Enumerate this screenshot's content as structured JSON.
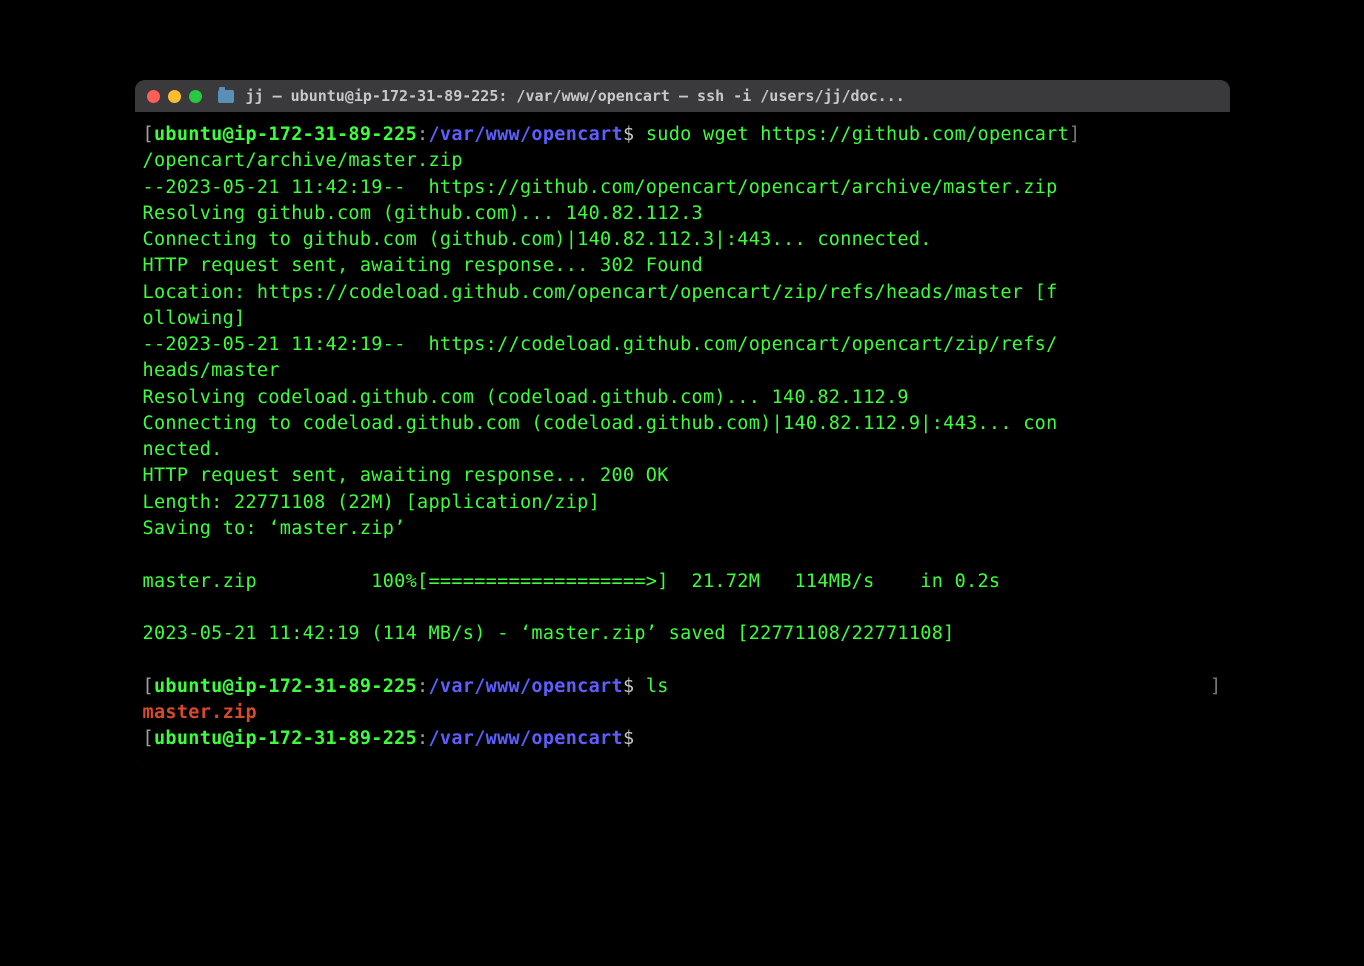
{
  "window": {
    "title": "jj — ubuntu@ip-172-31-89-225: /var/www/opencart — ssh -i /users/jj/doc..."
  },
  "prompt": {
    "lbracket": "[",
    "rbracket": "]",
    "user_host": "ubuntu@ip-172-31-89-225",
    "colon": ":",
    "path": "/var/www/opencart",
    "dollar": "$"
  },
  "commands": {
    "wget": " sudo wget https://github.com/opencart",
    "wget_cont": "/opencart/archive/master.zip",
    "ls": " ls"
  },
  "output": {
    "l1": "--2023-05-21 11:42:19--  https://github.com/opencart/opencart/archive/master.zip",
    "l2": "Resolving github.com (github.com)... 140.82.112.3",
    "l3": "Connecting to github.com (github.com)|140.82.112.3|:443... connected.",
    "l4": "HTTP request sent, awaiting response... 302 Found",
    "l5": "Location: https://codeload.github.com/opencart/opencart/zip/refs/heads/master [f",
    "l6": "ollowing]",
    "l7": "--2023-05-21 11:42:19--  https://codeload.github.com/opencart/opencart/zip/refs/",
    "l8": "heads/master",
    "l9": "Resolving codeload.github.com (codeload.github.com)... 140.82.112.9",
    "l10": "Connecting to codeload.github.com (codeload.github.com)|140.82.112.9|:443... con",
    "l11": "nected.",
    "l12": "HTTP request sent, awaiting response... 200 OK",
    "l13": "Length: 22771108 (22M) [application/zip]",
    "l14": "Saving to: ‘master.zip’",
    "blank": " ",
    "progress": "master.zip          100%[===================>]  21.72M   114MB/s    in 0.2s   ",
    "summary": "2023-05-21 11:42:19 (114 MB/s) - ‘master.zip’ saved [22771108/22771108]"
  },
  "ls_out": {
    "file": "master.zip"
  }
}
